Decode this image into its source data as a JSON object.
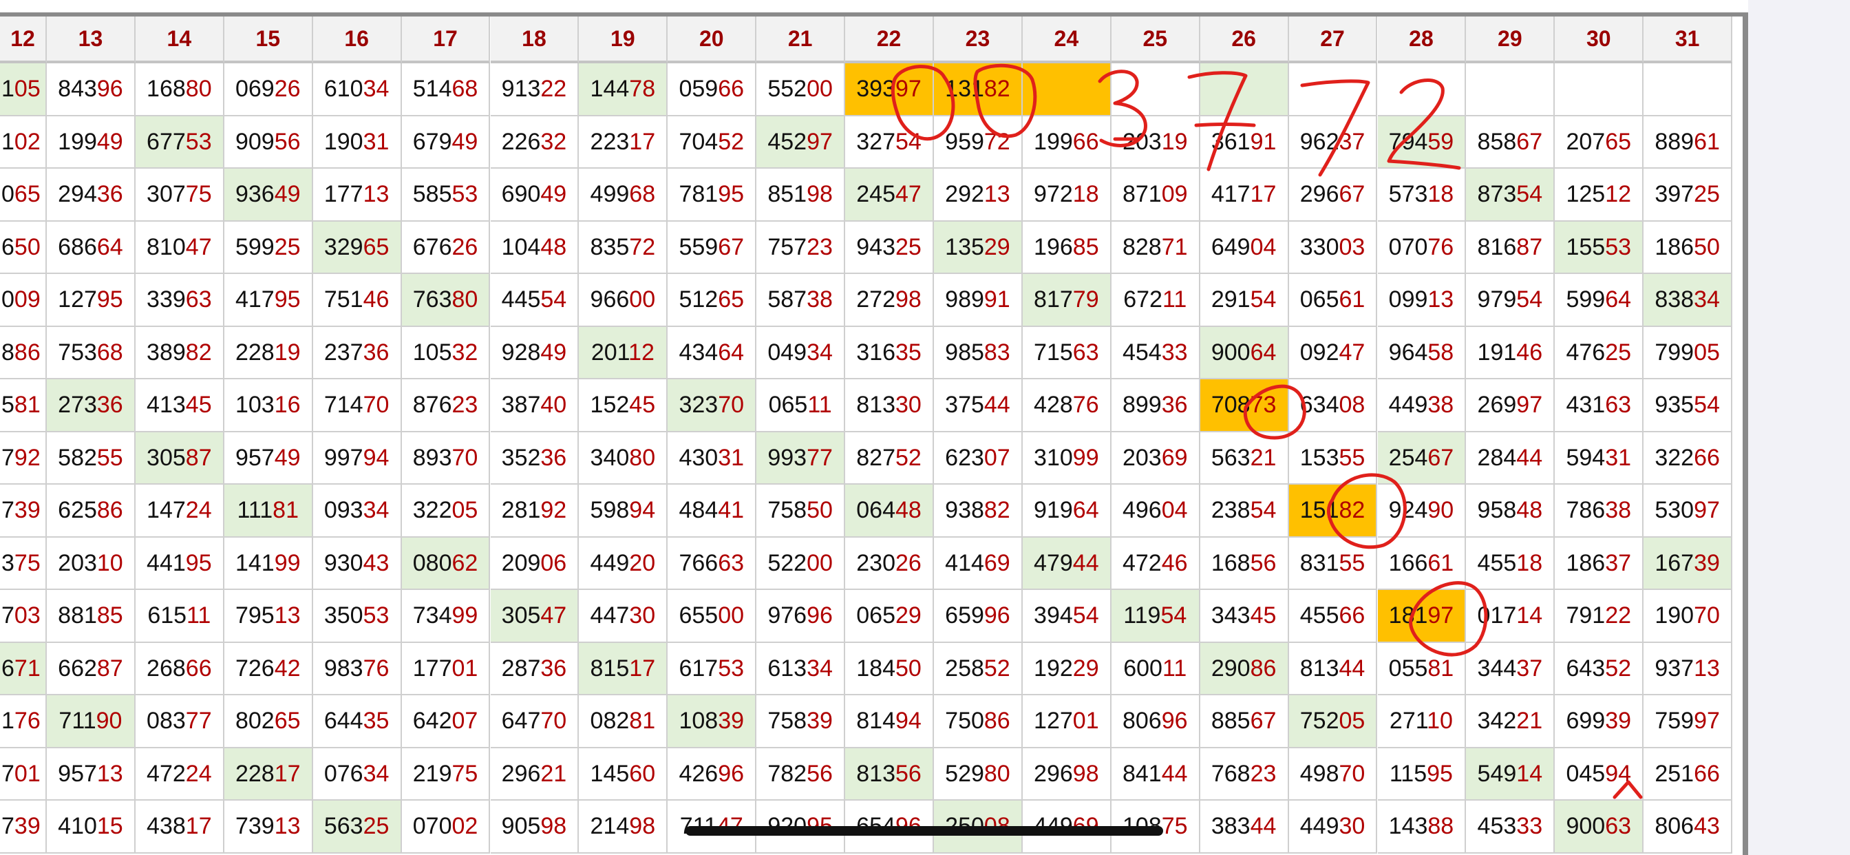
{
  "table": {
    "headers": [
      "12",
      "13",
      "14",
      "15",
      "16",
      "17",
      "18",
      "19",
      "20",
      "21",
      "22",
      "23",
      "24",
      "25",
      "26",
      "27",
      "28",
      "29",
      "30",
      "31"
    ],
    "rows": [
      [
        "105",
        "84396",
        "16880",
        "06926",
        "61034",
        "51468",
        "91322",
        "14478",
        "05966",
        "55200",
        "39397",
        "13182",
        "",
        "",
        "",
        "",
        "",
        "",
        "",
        ""
      ],
      [
        "102",
        "19949",
        "67753",
        "90956",
        "19031",
        "67949",
        "22632",
        "22317",
        "70452",
        "45297",
        "32754",
        "95972",
        "19966",
        "20319",
        "36191",
        "96237",
        "79459",
        "85867",
        "20765",
        "88961"
      ],
      [
        "065",
        "29436",
        "30775",
        "93649",
        "17713",
        "58553",
        "69049",
        "49968",
        "78195",
        "85198",
        "24547",
        "29213",
        "97218",
        "87109",
        "41717",
        "29667",
        "57318",
        "87354",
        "12512",
        "39725"
      ],
      [
        "650",
        "68664",
        "81047",
        "59925",
        "32965",
        "67626",
        "10448",
        "83572",
        "55967",
        "75723",
        "94325",
        "13529",
        "19685",
        "82871",
        "64904",
        "33003",
        "07076",
        "81687",
        "15553",
        "18650"
      ],
      [
        "009",
        "12795",
        "33963",
        "41795",
        "75146",
        "76380",
        "44554",
        "96600",
        "51265",
        "58738",
        "27298",
        "98991",
        "81779",
        "67211",
        "29154",
        "06561",
        "09913",
        "97954",
        "59964",
        "83834"
      ],
      [
        "886",
        "75368",
        "38982",
        "22819",
        "23736",
        "10532",
        "92849",
        "20112",
        "43464",
        "04934",
        "31635",
        "98583",
        "71563",
        "45433",
        "90064",
        "09247",
        "96458",
        "19146",
        "47625",
        "79905"
      ],
      [
        "581",
        "27336",
        "41345",
        "10316",
        "71470",
        "87623",
        "38740",
        "15245",
        "32370",
        "06511",
        "81330",
        "37544",
        "42876",
        "89936",
        "70873",
        "63408",
        "44938",
        "26997",
        "43163",
        "93554"
      ],
      [
        "792",
        "58255",
        "30587",
        "95749",
        "99794",
        "89370",
        "35236",
        "34080",
        "43031",
        "99377",
        "82752",
        "62307",
        "31099",
        "20369",
        "56321",
        "15355",
        "25467",
        "28444",
        "59431",
        "32266"
      ],
      [
        "739",
        "62586",
        "14724",
        "11181",
        "09334",
        "32205",
        "28192",
        "59894",
        "48441",
        "75850",
        "06448",
        "93882",
        "91964",
        "49604",
        "23854",
        "15182",
        "92490",
        "95848",
        "78638",
        "53097"
      ],
      [
        "375",
        "20310",
        "44195",
        "14199",
        "93043",
        "08062",
        "20906",
        "44920",
        "76663",
        "52200",
        "23026",
        "41469",
        "47944",
        "47246",
        "16856",
        "83155",
        "16661",
        "45518",
        "18637",
        "16739"
      ],
      [
        "703",
        "88185",
        "61511",
        "79513",
        "35053",
        "73499",
        "30547",
        "44730",
        "65500",
        "97696",
        "06529",
        "65996",
        "39454",
        "11954",
        "34345",
        "45566",
        "18197",
        "01714",
        "79122",
        "19070"
      ],
      [
        "671",
        "66287",
        "26866",
        "72642",
        "98376",
        "17701",
        "28736",
        "81517",
        "61753",
        "61334",
        "18450",
        "25852",
        "19229",
        "60011",
        "29086",
        "81344",
        "05581",
        "34437",
        "64352",
        "93713"
      ],
      [
        "176",
        "71190",
        "08377",
        "80265",
        "64435",
        "64207",
        "64770",
        "08281",
        "10839",
        "75839",
        "81494",
        "75086",
        "12701",
        "80696",
        "88567",
        "75205",
        "27110",
        "34221",
        "69939",
        "75997"
      ],
      [
        "701",
        "95713",
        "47224",
        "22817",
        "07634",
        "21975",
        "29621",
        "14560",
        "42696",
        "78256",
        "81356",
        "52980",
        "29698",
        "84144",
        "76823",
        "49870",
        "11595",
        "54914",
        "04594",
        "25166"
      ],
      [
        "739",
        "41015",
        "43817",
        "73913",
        "56325",
        "07002",
        "90598",
        "21498",
        "71147",
        "92095",
        "65496",
        "25008",
        "44969",
        "10875",
        "38344",
        "44930",
        "14388",
        "45333",
        "90063",
        "80643"
      ]
    ],
    "highlights": {
      "green": [
        "0-0",
        "0-7",
        "0-14",
        "1-2",
        "1-9",
        "1-16",
        "2-3",
        "2-10",
        "2-17",
        "3-4",
        "3-11",
        "3-18",
        "4-5",
        "4-12",
        "4-19",
        "5-7",
        "5-14",
        "6-1",
        "6-8",
        "7-2",
        "7-9",
        "7-16",
        "8-3",
        "8-10",
        "9-5",
        "9-12",
        "9-19",
        "10-6",
        "10-13",
        "11-0",
        "11-7",
        "11-14",
        "12-1",
        "12-8",
        "12-15",
        "13-3",
        "13-10",
        "13-17",
        "14-4",
        "14-11",
        "14-18"
      ],
      "orange": [
        "0-10",
        "0-11",
        "0-12",
        "6-14",
        "8-15",
        "10-16"
      ]
    },
    "colors": {
      "header_bg": "#f2f2f2",
      "header_text": "#9a0000",
      "digit_text": "#111111",
      "tail_digit_text": "#b00000",
      "green_highlight": "#e2f0d9",
      "orange_highlight": "#ffc000",
      "grid_line": "#cfcfcf",
      "ink_red": "#e0201b",
      "frame": "#8a8a8a"
    }
  },
  "annotations": {
    "handwriting": "3772",
    "tool": "red-pen"
  }
}
